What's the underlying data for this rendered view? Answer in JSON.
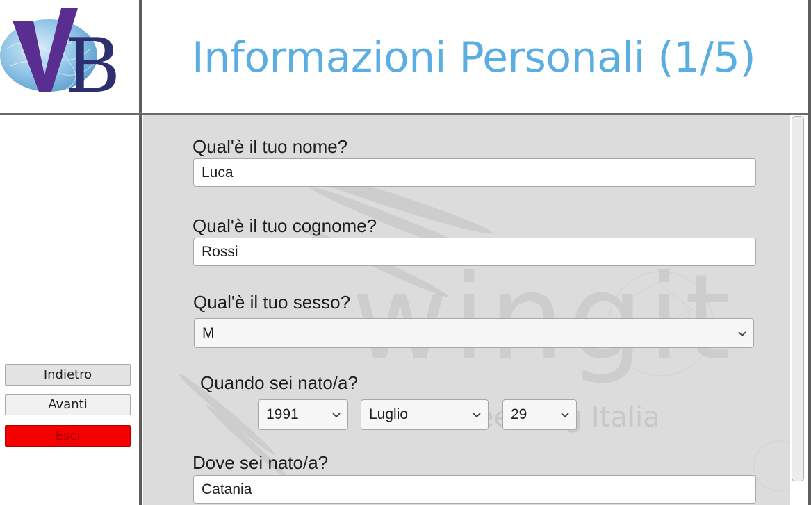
{
  "logo": {
    "letters": "VB"
  },
  "header": {
    "title": "Informazioni Personali (1/5)"
  },
  "sidebar": {
    "back_label": "Indietro",
    "next_label": "Avanti",
    "exit_label": "Esci"
  },
  "watermark": {
    "brand": "wingit",
    "tagline": "eeering Italia"
  },
  "form": {
    "name": {
      "label": "Qual'è il tuo nome?",
      "value": "Luca"
    },
    "surname": {
      "label": "Qual'è il tuo cognome?",
      "value": "Rossi"
    },
    "sex": {
      "label": "Qual'è il tuo sesso?",
      "value": "M"
    },
    "birthdate": {
      "label": "Quando sei nato/a?",
      "year": "1991",
      "month": "Luglio",
      "day": "29"
    },
    "birthplace": {
      "label": "Dove sei nato/a?",
      "value": "Catania"
    }
  },
  "colors": {
    "title": "#5aaee1",
    "exit_button": "#f50000",
    "content_background": "#dcdcdc",
    "logo_purple": "#5a2d91",
    "logo_navy": "#2e2f6e"
  },
  "icons": [
    "chevron-down-icon",
    "vb-logo"
  ]
}
